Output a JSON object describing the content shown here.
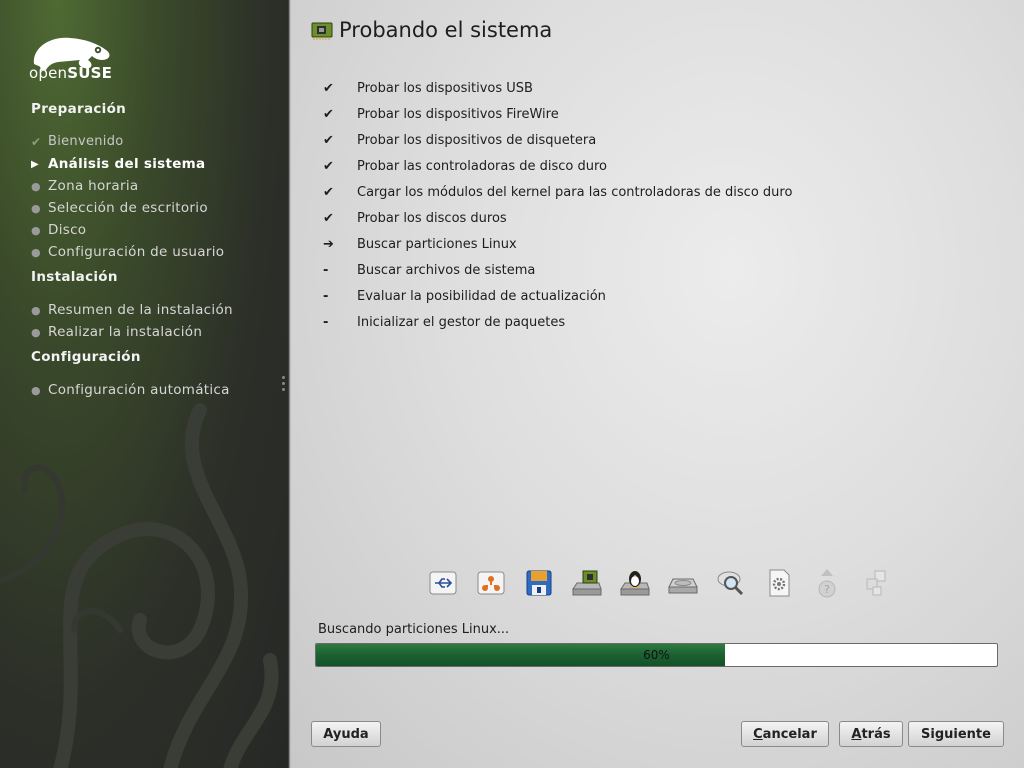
{
  "sidebar": {
    "logo": {
      "prefix": "open",
      "brand": "SUSE"
    },
    "sections": [
      {
        "title": "Preparación",
        "steps": [
          {
            "label": "Bienvenido",
            "state": "done"
          },
          {
            "label": "Análisis del sistema",
            "state": "current"
          },
          {
            "label": "Zona horaria",
            "state": "pending"
          },
          {
            "label": "Selección de escritorio",
            "state": "pending"
          },
          {
            "label": "Disco",
            "state": "pending"
          },
          {
            "label": "Configuración de usuario",
            "state": "pending"
          }
        ]
      },
      {
        "title": "Instalación",
        "steps": [
          {
            "label": "Resumen de la instalación",
            "state": "pending"
          },
          {
            "label": "Realizar la instalación",
            "state": "pending"
          }
        ]
      },
      {
        "title": "Configuración",
        "steps": [
          {
            "label": "Configuración automática",
            "state": "pending"
          }
        ]
      }
    ]
  },
  "main": {
    "title": "Probando el sistema",
    "tasks": [
      {
        "status": "✔",
        "label": "Probar los dispositivos USB"
      },
      {
        "status": "✔",
        "label": "Probar los dispositivos FireWire"
      },
      {
        "status": "✔",
        "label": "Probar los dispositivos de disquetera"
      },
      {
        "status": "✔",
        "label": "Probar las controladoras de disco duro"
      },
      {
        "status": "✔",
        "label": "Cargar los módulos del kernel para las controladoras de disco duro"
      },
      {
        "status": "✔",
        "label": "Probar los discos duros"
      },
      {
        "status": "➔",
        "label": "Buscar particiones Linux"
      },
      {
        "status": "-",
        "label": "Buscar archivos de sistema"
      },
      {
        "status": "-",
        "label": "Evaluar la posibilidad de actualización"
      },
      {
        "status": "-",
        "label": "Inicializar el gestor de paquetes"
      }
    ],
    "device_icons": [
      "usb-icon",
      "firewire-icon",
      "floppy-icon",
      "disk-controller-icon",
      "linux-penguin-icon",
      "hard-disk-icon",
      "search-partitions-icon",
      "system-files-icon",
      "update-question-icon",
      "package-manager-icon"
    ],
    "progress": {
      "label": "Buscando particiones Linux...",
      "value": 60,
      "text": "60%"
    }
  },
  "buttons": {
    "help": {
      "mnemonic": "",
      "rest": "Ayuda"
    },
    "cancel": {
      "mnemonic": "C",
      "rest": "ancelar"
    },
    "back": {
      "mnemonic": "A",
      "rest": "trás"
    },
    "next": {
      "mnemonic": "",
      "rest": "Siguiente"
    }
  },
  "colors": {
    "progress_fill": "#1d6232",
    "sidebar_bg": "#2c2f28",
    "accent_green": "#4f6a33"
  }
}
